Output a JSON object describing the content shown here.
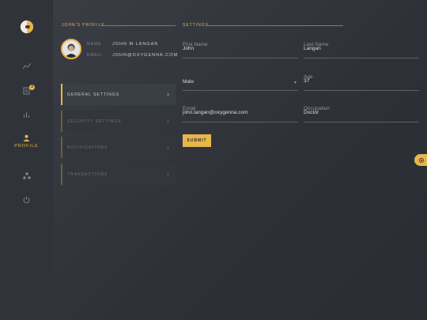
{
  "profile_section": {
    "title": "JOHN'S PROFILE",
    "name_key": "NAME",
    "name_value": "JOHN M LANGAN",
    "email_key": "EMAIL",
    "email_value": "JOHN@OXYGENNA.COM"
  },
  "sidebar": {
    "profile_label": "PROFILE",
    "badge_count": "3"
  },
  "menu": [
    {
      "label": "GENERAL SETTINGS"
    },
    {
      "label": "SECURITY SETTINGS"
    },
    {
      "label": "NOTIFICATIONS"
    },
    {
      "label": "TRANSACTIONS"
    }
  ],
  "settings": {
    "title": "SETTINGS",
    "first_name_label": "First Name",
    "first_name_value": "John",
    "last_name_label": "Last Name",
    "last_name_value": "Langan",
    "gender_value": "Male",
    "age_label": "Age",
    "age_value": "37",
    "email_label": "Email",
    "email_value": "john.langan@oxygenna.com",
    "occupation_label": "Occupation",
    "occupation_value": "Doctor",
    "submit_label": "SUBMIT"
  },
  "colors": {
    "accent": "#e8b64a",
    "background": "#2b2f35",
    "sidebar": "#30343a"
  }
}
